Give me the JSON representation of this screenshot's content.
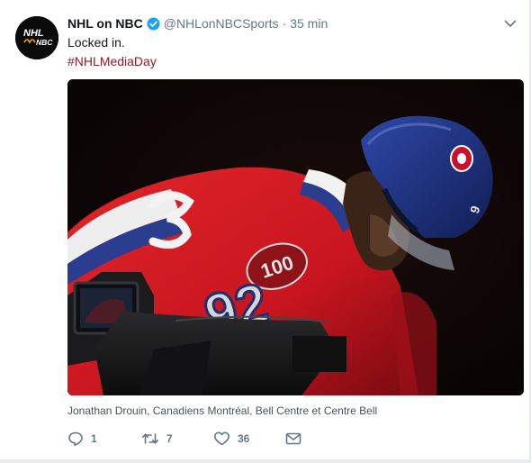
{
  "tweet": {
    "author": {
      "avatar_text_1": "NHL",
      "avatar_text_2": "NBC",
      "name": "NHL on NBC",
      "handle": "@NHLonNBCSports",
      "separator": "·",
      "time": "35 min",
      "verified_icon": "verified-badge-icon"
    },
    "menu_icon": "chevron-down-icon",
    "text": "Locked in.",
    "hashtag": "#NHLMediaDay",
    "media": {
      "jersey_number": "92",
      "anniversary_logo": "100",
      "helmet_number": "9"
    },
    "caption": "Jonathan Drouin, Canadiens Montréal, Bell Centre et Centre Bell",
    "actions": [
      {
        "icon": "reply-icon",
        "count": "1"
      },
      {
        "icon": "retweet-icon",
        "count": "7"
      },
      {
        "icon": "heart-icon",
        "count": "36"
      },
      {
        "icon": "mail-icon",
        "count": ""
      }
    ],
    "colors": {
      "hashtag": "#8b1c2a",
      "muted": "#657786",
      "verified": "#1da1f2",
      "jersey_red": "#c8102e",
      "helmet_blue": "#1b2f73"
    }
  }
}
